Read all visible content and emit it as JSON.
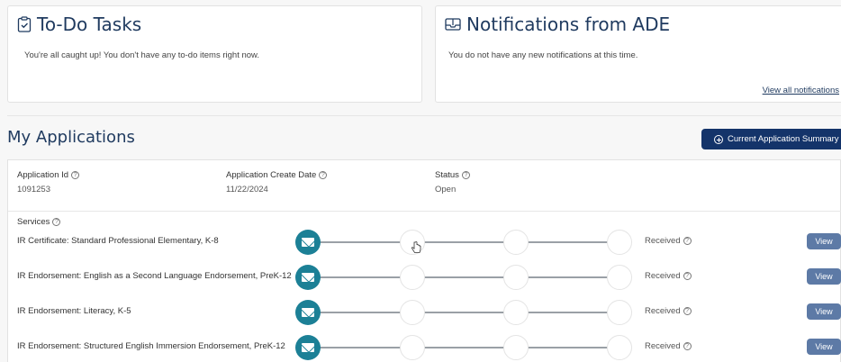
{
  "todo": {
    "title": "To-Do Tasks",
    "icon": "clipboard-check-icon",
    "message": "You're all caught up! You don't have any to-do items right now."
  },
  "notifications": {
    "title": "Notifications from ADE",
    "icon": "inbox-icon",
    "message": "You do not have any new notifications at this time.",
    "view_all_label": "View all notifications"
  },
  "applications": {
    "title": "My Applications",
    "summary_button_label": "Current Application Summary",
    "summary_button_icon": "plus-circle-icon",
    "fields": {
      "id_label": "Application Id",
      "id_value": "1091253",
      "date_label": "Application Create Date",
      "date_value": "11/22/2024",
      "status_label": "Status",
      "status_value": "Open"
    },
    "services_label": "Services",
    "services": [
      {
        "name": "IR Certificate: Standard Professional Elementary, K-8",
        "status": "Received",
        "view_label": "View",
        "progress_step": 1,
        "steps_total": 4
      },
      {
        "name": "IR Endorsement: English as a Second Language Endorsement, PreK-12",
        "status": "Received",
        "view_label": "View",
        "progress_step": 1,
        "steps_total": 4
      },
      {
        "name": "IR Endorsement: Literacy, K-5",
        "status": "Received",
        "view_label": "View",
        "progress_step": 1,
        "steps_total": 4
      },
      {
        "name": "IR Endorsement: Structured English Immersion Endorsement, PreK-12",
        "status": "Received",
        "view_label": "View",
        "progress_step": 1,
        "steps_total": 4
      }
    ]
  },
  "colors": {
    "primary_dark": "#14346a",
    "title_blue": "#1f3a5f",
    "step_active": "#1c8096",
    "view_button": "#5d7aa6"
  }
}
